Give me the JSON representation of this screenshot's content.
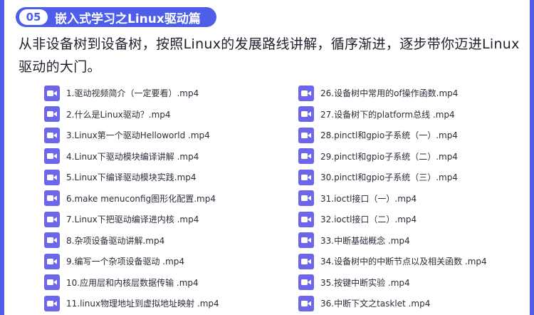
{
  "colors": {
    "accent": "#4f5ee8",
    "icon": "#6d66e8",
    "text": "#1f1f2e"
  },
  "header": {
    "number": "05",
    "title": "嵌入式学习之Linux驱动篇"
  },
  "intro": "从非设备树到设备树，按照Linux的发展路线讲解，循序渐进，逐步带你迈进Linux驱动的大门。",
  "files_left": [
    {
      "icon": "video-file-icon",
      "name": "1.驱动视频简介（一定要看）.mp4"
    },
    {
      "icon": "video-file-icon",
      "name": "2.什么是Linux驱动？.mp4"
    },
    {
      "icon": "video-file-icon",
      "name": "3.Linux第一个驱动Helloworld .mp4"
    },
    {
      "icon": "video-file-icon",
      "name": "4.Linux下驱动模块编译讲解 .mp4"
    },
    {
      "icon": "video-file-icon",
      "name": "5.Linux下编译驱动模块实践.mp4"
    },
    {
      "icon": "video-file-icon",
      "name": "6.make menuconfig图形化配置.mp4"
    },
    {
      "icon": "video-file-icon",
      "name": "7.Linux下把驱动编译进内核  .mp4"
    },
    {
      "icon": "video-file-icon",
      "name": "8.杂项设备驱动讲解.mp4"
    },
    {
      "icon": "video-file-icon",
      "name": "9.编写一个杂项设备驱动 .mp4"
    },
    {
      "icon": "video-file-icon",
      "name": "10.应用层和内核层数据传输 .mp4"
    },
    {
      "icon": "video-file-icon",
      "name": "11.linux物理地址到虚拟地址映射 .mp4"
    }
  ],
  "files_right": [
    {
      "icon": "video-file-icon",
      "name": "26.设备树中常用的of操作函数.mp4"
    },
    {
      "icon": "video-file-icon",
      "name": "27.设备树下的platform总线 .mp4"
    },
    {
      "icon": "video-file-icon",
      "name": "28.pinctl和gpio子系统（一）.mp4"
    },
    {
      "icon": "video-file-icon",
      "name": "29.pinctl和gpio子系统（二）.mp4"
    },
    {
      "icon": "video-file-icon",
      "name": "30.pinctl和gpio子系统（三）.mp4"
    },
    {
      "icon": "video-file-icon",
      "name": "31.ioctl接口（一）.mp4"
    },
    {
      "icon": "video-file-icon",
      "name": "32.ioctl接口（二）.mp4"
    },
    {
      "icon": "video-file-icon",
      "name": "33.中断基础概念 .mp4"
    },
    {
      "icon": "video-file-icon",
      "name": "34.设备树中的中断节点以及相关函数 .mp4"
    },
    {
      "icon": "video-file-icon",
      "name": "35.按键中断实验 .mp4"
    },
    {
      "icon": "video-file-icon",
      "name": "36.中断下文之tasklet .mp4"
    }
  ]
}
